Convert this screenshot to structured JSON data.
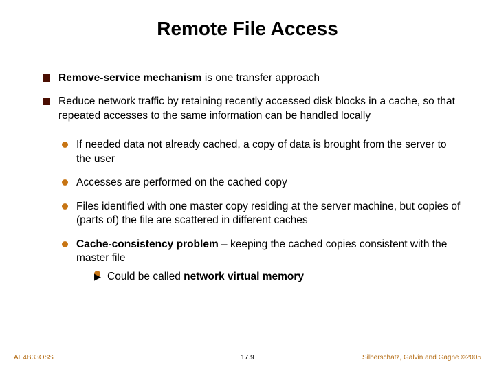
{
  "title": "Remote File Access",
  "bullets": {
    "b1_prefix": "Remove-service mechanism",
    "b1_rest": " is one transfer approach",
    "b2": "Reduce network traffic by retaining recently accessed disk blocks in a cache, so that repeated accesses to the same information can be handled locally",
    "s1": "If needed data not already cached, a copy of data is brought from the server to the user",
    "s2": "Accesses are performed on the cached copy",
    "s3": "Files identified with one master copy residing at the server machine, but copies of (parts of) the file are scattered in different caches",
    "s4_prefix": "Cache-consistency problem",
    "s4_rest": " – keeping the cached copies consistent with the master file",
    "s4_sub_pre": "Could be called ",
    "s4_sub_bold": "network virtual memory"
  },
  "footer": {
    "left": "AE4B33OSS",
    "center": "17.9",
    "right": "Silberschatz, Galvin and Gagne ©2005"
  }
}
